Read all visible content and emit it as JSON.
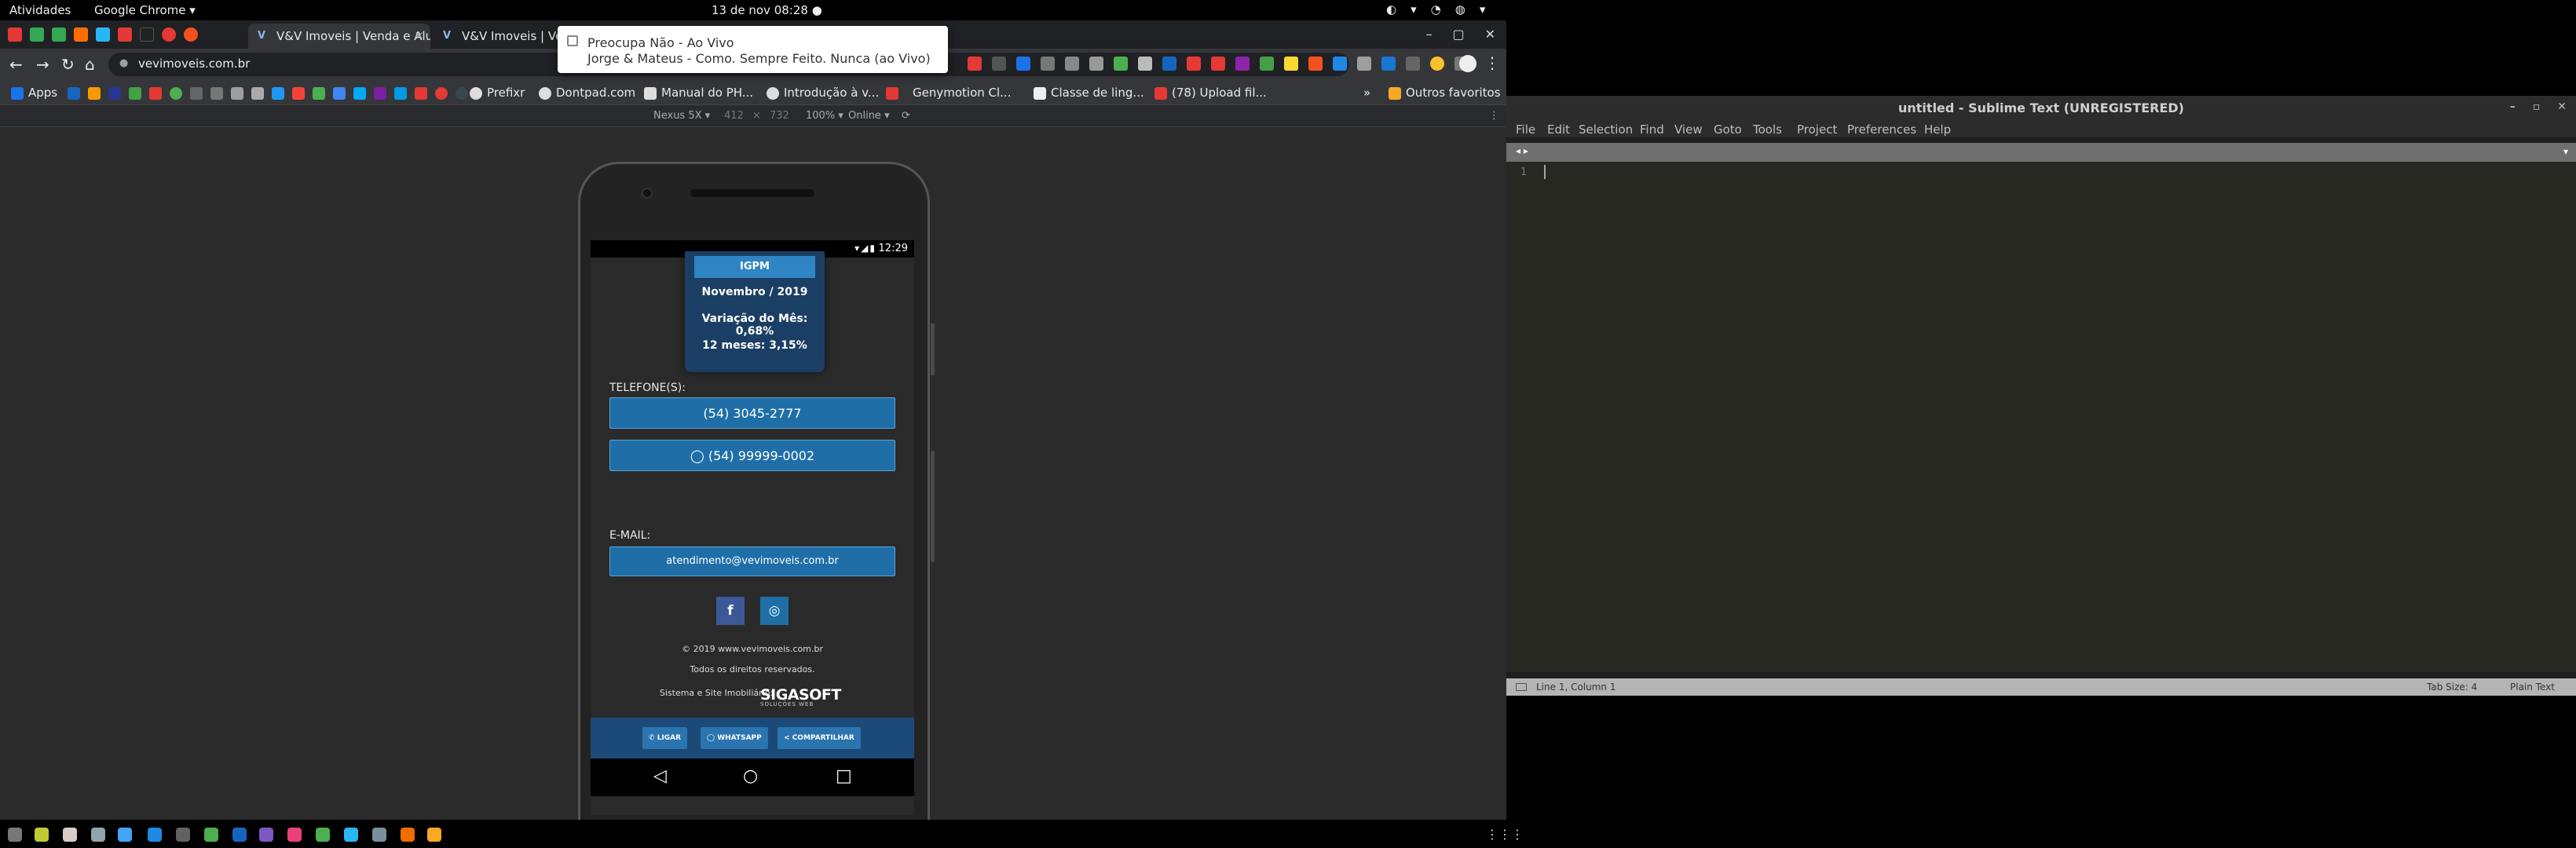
{
  "gnome": {
    "activities": "Atividades",
    "app_menu": "Google Chrome ▾",
    "clock": "13 de nov  08:28 ●",
    "tray": [
      "◐",
      "▾",
      "◔",
      "◍",
      "▾"
    ]
  },
  "chrome": {
    "tabs": [
      {
        "label": "V&V Imoveis | Venda e Alu",
        "favicon": "V",
        "close": "×"
      },
      {
        "label": "V&V Imoveis | Ven",
        "favicon": "V"
      }
    ],
    "window_controls": [
      "–",
      "▢",
      "✕"
    ],
    "url": "vevimoveis.com.br",
    "nav": {
      "back": "←",
      "forward": "→",
      "reload": "↻",
      "home": "⌂"
    },
    "menu": "⋮",
    "bookmarks": [
      {
        "label": "Apps"
      },
      {
        "label": "Prefixr"
      },
      {
        "label": "Dontpad.com"
      },
      {
        "label": "Manual do PH..."
      },
      {
        "label": "Introdução à v..."
      },
      {
        "label": "Genymotion Cl..."
      },
      {
        "label": "Classe de ling..."
      },
      {
        "label": "(78) Upload fil..."
      },
      {
        "label": "»"
      },
      {
        "label": "Outros favoritos"
      }
    ],
    "notification": {
      "title": "Preocupa Não - Ao Vivo",
      "body": "Jorge & Mateus - Como. Sempre Feito. Nunca (ao Vivo)"
    },
    "devtools": {
      "device": "Nexus 5X ▾",
      "width": "412",
      "times": "×",
      "height": "732",
      "zoom": "100% ▾",
      "network": "Online ▾",
      "rotate": "⟳",
      "menu": "⋮"
    }
  },
  "site": {
    "status_time": "12:29",
    "status_icons": "▾◢▮",
    "igpm": {
      "title": "IGPM",
      "month": "Novembro / 2019",
      "variation": "Variação do Mês: 0,68%",
      "twelve": "12 meses: 3,15%"
    },
    "phones_label": "TELEFONE(S):",
    "phone1": "(54) 3045-2777",
    "phone2": "(54) 99999-0002",
    "whatsapp_glyph": "◯",
    "email_label": "E-MAIL:",
    "email": "atendimento@vevimoveis.com.br",
    "facebook_glyph": "f",
    "instagram_glyph": "◎",
    "copyright": "© 2019 www.vevimoveis.com.br",
    "rights": "Todos os direitos reservados.",
    "credit": "Sistema e Site Imobiliário:",
    "siga": "SIGASOFT",
    "siga_sub": "SOLUÇÕES WEB",
    "actions": {
      "call": "LIGAR",
      "whatsapp": "WHATSAPP",
      "share": "COMPARTILHAR"
    },
    "action_icons": {
      "call": "✆",
      "whatsapp": "◯",
      "share": "<"
    },
    "nav": {
      "back": "◁",
      "home": "○",
      "recents": "□"
    }
  },
  "sublime": {
    "title": "untitled - Sublime Text (UNREGISTERED)",
    "controls": [
      "–",
      "▫",
      "✕"
    ],
    "menu": [
      "File",
      "Edit",
      "Selection",
      "Find",
      "View",
      "Goto",
      "Tools",
      "Project",
      "Preferences",
      "Help"
    ],
    "tab_arrows": "◂ ▸",
    "tab_dropdown": "▾",
    "line_number": "1",
    "status_left": "Line 1, Column 1",
    "tab_size": "Tab Size: 4",
    "syntax": "Plain Text"
  },
  "dock": {
    "grid": "⋮⋮⋮"
  },
  "colors": {
    "accent_blue": "#1f6ea7",
    "igpm_bg": "#1b3f64",
    "action_bar": "#1b4a78",
    "facebook": "#3b5998",
    "instagram": "#1d6fa5"
  }
}
